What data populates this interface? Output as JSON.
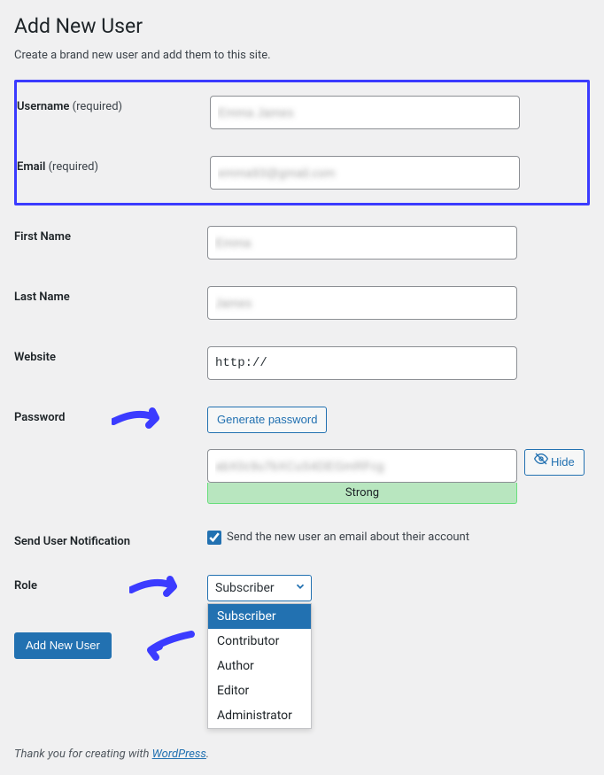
{
  "header": {
    "title": "Add New User",
    "subtitle": "Create a brand new user and add them to this site."
  },
  "fields": {
    "username": {
      "label": "Username",
      "req": "(required)",
      "value": "Emma James"
    },
    "email": {
      "label": "Email",
      "req": "(required)",
      "value": "emma93@gmail.com"
    },
    "first_name": {
      "label": "First Name",
      "value": "Emma"
    },
    "last_name": {
      "label": "Last Name",
      "value": "James"
    },
    "website": {
      "label": "Website",
      "value": "http://"
    },
    "password": {
      "label": "Password",
      "generate_label": "Generate password",
      "value": "abX0c9u7bXCuS4DEGmRFcg",
      "strength": "Strong",
      "hide_label": "Hide"
    },
    "notification": {
      "label": "Send User Notification",
      "text": "Send the new user an email about their account",
      "checked": true
    },
    "role": {
      "label": "Role",
      "selected": "Subscriber",
      "options": [
        "Subscriber",
        "Contributor",
        "Author",
        "Editor",
        "Administrator"
      ]
    }
  },
  "submit": {
    "label": "Add New User"
  },
  "footer": {
    "prefix": "Thank you for creating with ",
    "link": "WordPress",
    "suffix": "."
  }
}
